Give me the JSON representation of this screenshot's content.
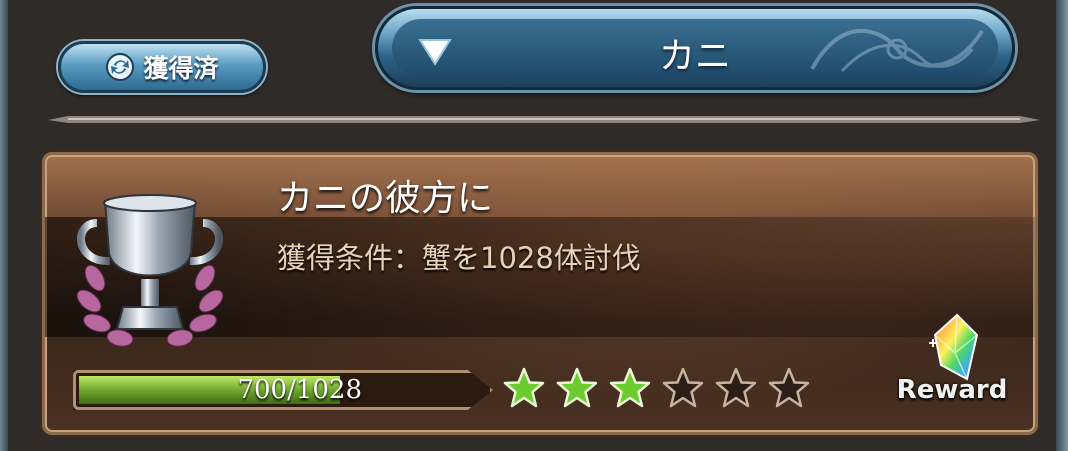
{
  "toolbar": {
    "acquired_label": "獲得済",
    "filter_label": "カニ"
  },
  "achievement": {
    "title": "カニの彼方に",
    "condition": "獲得条件：蟹を1028体討伐",
    "progress_current": 700,
    "progress_total": 1028,
    "progress_text": "700/1028",
    "stars_total": 6,
    "stars_earned": 3,
    "reward_label": "Reward"
  },
  "colors": {
    "star_earned": "#6ccb2e",
    "star_empty": "#2a1e16",
    "progress_fill": "#6aa32a"
  },
  "icons": {
    "acquired": "refresh-icon",
    "filter": "triangle-down-icon",
    "trophy": "trophy-icon",
    "reward": "rainbow-crystal-icon",
    "star": "star-icon"
  }
}
